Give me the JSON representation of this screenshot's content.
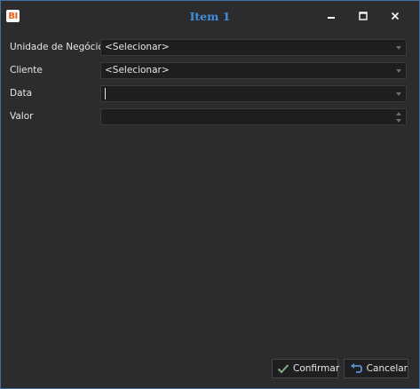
{
  "window": {
    "title": "Item 1",
    "app_icon_text": "BI"
  },
  "form": {
    "unidade": {
      "label": "Unidade de Negócio",
      "value": "<Selecionar>"
    },
    "cliente": {
      "label": "Cliente",
      "value": "<Selecionar>"
    },
    "data": {
      "label": "Data",
      "value": ""
    },
    "valor": {
      "label": "Valor",
      "value": ""
    }
  },
  "actions": {
    "confirm_label": "Confirmar",
    "cancel_label": "Cancelar"
  },
  "colors": {
    "background": "#2c2c2e",
    "title": "#3d8fe0",
    "accent_check": "#7fb08a",
    "accent_cancel": "#5a8fd0",
    "icon_orange": "#e8631c"
  },
  "icons": {
    "app": "bi-logo-icon",
    "minimize": "minimize-icon",
    "maximize": "maximize-icon",
    "close": "close-icon",
    "confirm": "check-icon",
    "cancel": "undo-icon"
  }
}
